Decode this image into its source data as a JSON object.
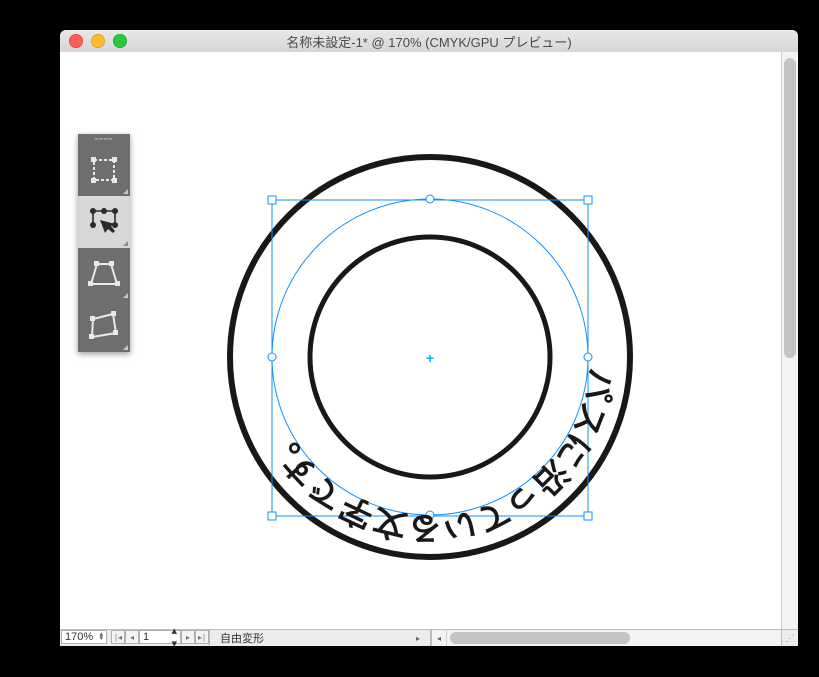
{
  "window": {
    "title": "名称未設定-1* @ 170% (CMYK/GPU プレビュー)"
  },
  "zoom": "170%",
  "artboard": "1",
  "tool_label": "自由変形",
  "tools": [
    {
      "name": "free-transform-mode",
      "label": "自由変形",
      "active": false
    },
    {
      "name": "puppet-warp-mode",
      "label": "パペットワープ",
      "active": true
    },
    {
      "name": "perspective-distort-mode",
      "label": "遠近変形",
      "active": false
    },
    {
      "name": "free-distort-mode",
      "label": "自由に変形",
      "active": false
    }
  ],
  "canvas": {
    "ring_outer_stroke_px": 6,
    "ring_inner_stroke_px": 5,
    "selection_color": "#1191ff",
    "text_on_path": "パスに沿っている文字です。"
  }
}
